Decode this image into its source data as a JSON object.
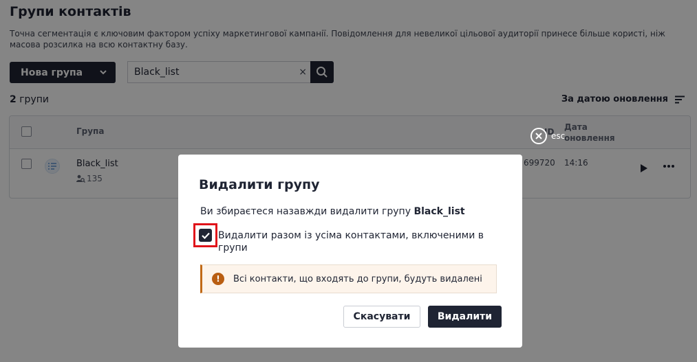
{
  "page": {
    "title": "Групи контактів",
    "description": "Точна сегментація є ключовим фактором успіху маркетингової кампанії. Повідомлення для невеликої цільової аудиторії принесе більше користі, ніж масова розсилка на всю контактну базу."
  },
  "toolbar": {
    "new_group_label": "Нова група",
    "search_value": "Black_list",
    "clear_glyph": "×"
  },
  "list": {
    "count_number": "2",
    "count_label": " групи",
    "sort_label": "За датою оновлення"
  },
  "table": {
    "col_group": "Група",
    "col_id": "ID",
    "col_date_line1": "Дата",
    "col_date_line2": "оновлення",
    "rows": [
      {
        "name": "Black_list",
        "contacts": "135",
        "id": "699720",
        "updated": "14:16"
      }
    ]
  },
  "esc_label": "esc",
  "modal": {
    "title": "Видалити групу",
    "text_prefix": "Ви збираєтеся назавжди видалити групу ",
    "group_name": "Black_list",
    "checkbox_label": "Видалити разом із усіма контактами, включеними в групи",
    "warning_glyph": "!",
    "warning_text": "Всі контакти, що входять до групи, будуть видалені",
    "cancel_label": "Скасувати",
    "delete_label": "Видалити"
  },
  "colors": {
    "primary": "#1f2433",
    "highlight": "#e0131a",
    "warning": "#b95e12"
  }
}
